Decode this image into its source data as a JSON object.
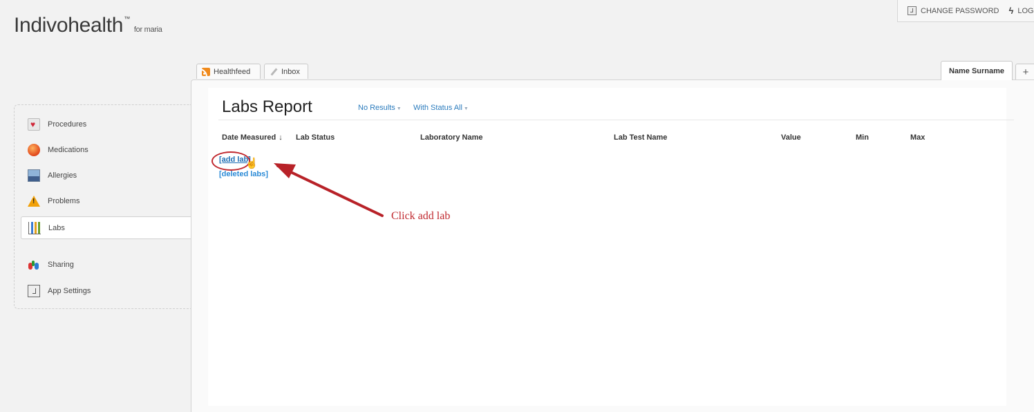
{
  "brand": {
    "name": "Indivohealth",
    "trademark": "™",
    "for_user": "for maria"
  },
  "account_bar": {
    "change_password": "CHANGE PASSWORD",
    "logout": "LOGOUT"
  },
  "tabs": [
    {
      "label": "Healthfeed",
      "icon": "rss-icon"
    },
    {
      "label": "Inbox",
      "icon": "inbox-icon"
    }
  ],
  "person_tab": {
    "label": "Name Surname"
  },
  "add_tab": {
    "label": "+"
  },
  "sidebar": {
    "items": [
      {
        "label": "Procedures",
        "icon": "procedures-icon"
      },
      {
        "label": "Medications",
        "icon": "medications-icon"
      },
      {
        "label": "Allergies",
        "icon": "allergies-icon"
      },
      {
        "label": "Problems",
        "icon": "problems-icon"
      },
      {
        "label": "Labs",
        "icon": "labs-icon",
        "active": true
      },
      {
        "label": "Sharing",
        "icon": "sharing-icon"
      },
      {
        "label": "App Settings",
        "icon": "app-settings-icon"
      }
    ]
  },
  "main": {
    "title": "Labs Report",
    "filters": {
      "results": "No Results",
      "status": "With Status All"
    },
    "columns": [
      "Date Measured",
      "Lab Status",
      "Laboratory Name",
      "Lab Test Name",
      "Value",
      "Min",
      "Max"
    ],
    "sort_indicator": "↓",
    "add_link": "[add lab]",
    "deleted_link": "[deleted labs]"
  },
  "annotation": {
    "text": "Click add lab",
    "color": "#c0282e"
  }
}
